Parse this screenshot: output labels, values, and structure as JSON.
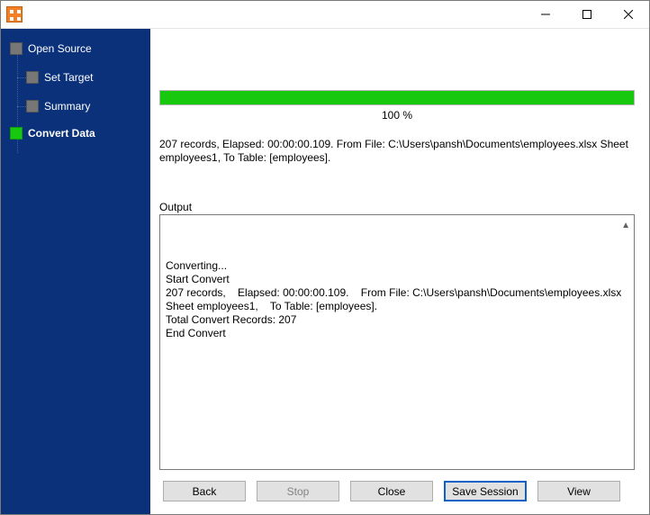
{
  "titlebar": {
    "title": ""
  },
  "sidebar": {
    "items": [
      {
        "label": "Open Source",
        "state": "done"
      },
      {
        "label": "Set Target",
        "state": "done"
      },
      {
        "label": "Summary",
        "state": "done"
      },
      {
        "label": "Convert Data",
        "state": "active"
      }
    ]
  },
  "progress": {
    "percent": 100,
    "percent_label": "100 %"
  },
  "summary": {
    "text": "207 records,    Elapsed: 00:00:00.109.    From File: C:\\Users\\pansh\\Documents\\employees.xlsx Sheet employees1,    To Table: [employees]."
  },
  "output": {
    "label": "Output",
    "lines": [
      "Converting...",
      "Start Convert",
      "207 records,    Elapsed: 00:00:00.109.    From File: C:\\Users\\pansh\\Documents\\employees.xlsx Sheet employees1,    To Table: [employees].",
      "Total Convert Records: 207",
      "End Convert"
    ]
  },
  "buttons": {
    "back": "Back",
    "stop": "Stop",
    "close": "Close",
    "save_session": "Save Session",
    "view": "View"
  }
}
